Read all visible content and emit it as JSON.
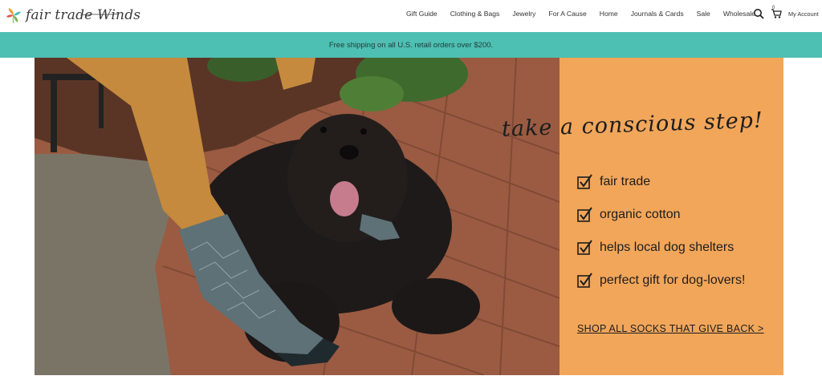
{
  "brand": {
    "name": "fair trade Winds",
    "logo_icon": "leaf-logo-icon"
  },
  "nav": {
    "items": [
      {
        "label": "Gift Guide"
      },
      {
        "label": "Clothing & Bags"
      },
      {
        "label": "Jewelry"
      },
      {
        "label": "For A Cause"
      },
      {
        "label": "Home"
      },
      {
        "label": "Journals & Cards"
      },
      {
        "label": "Sale"
      },
      {
        "label": "Wholesale"
      }
    ],
    "cart_count": "0",
    "account_label": "My Account",
    "icons": [
      "search-icon",
      "cart-icon"
    ]
  },
  "announcement": {
    "text": "Free shipping on all U.S. retail orders over $200."
  },
  "hero": {
    "tagline": "take a conscious step!",
    "checklist": [
      {
        "label": "fair trade"
      },
      {
        "label": "organic cotton"
      },
      {
        "label": "helps local dog shelters"
      },
      {
        "label": "perfect gift for dog-lovers!"
      }
    ],
    "cta_label": "SHOP ALL SOCKS THAT GIVE BACK >",
    "image_subject": "black curly dog lying on brick path beside person's legs in tan pants and grey socks"
  },
  "colors": {
    "banner": "#4ebfb3",
    "panel": "#f2a65a",
    "text": "#1d1d1d"
  }
}
